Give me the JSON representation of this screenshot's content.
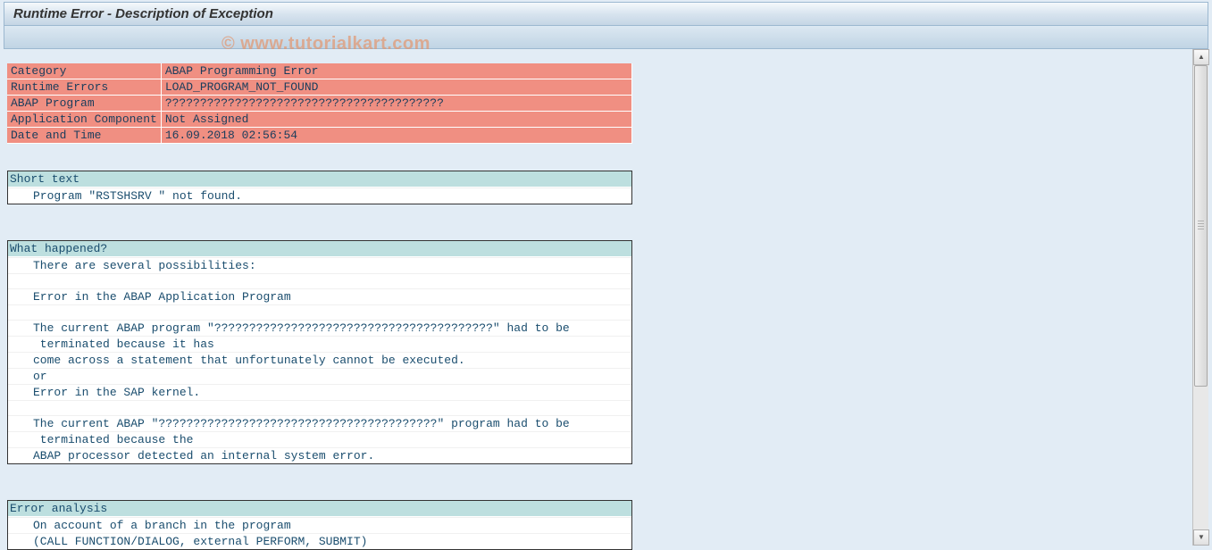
{
  "title": "Runtime Error - Description of Exception",
  "watermark": "© www.tutorialkart.com",
  "header": {
    "rows": [
      {
        "label": "Category",
        "value": "ABAP Programming Error"
      },
      {
        "label": "Runtime Errors",
        "value": "LOAD_PROGRAM_NOT_FOUND"
      },
      {
        "label": "ABAP Program",
        "value": "????????????????????????????????????????"
      },
      {
        "label": "Application Component",
        "value": "Not Assigned"
      },
      {
        "label": "Date and Time",
        "value": "16.09.2018 02:56:54"
      }
    ]
  },
  "sections": [
    {
      "title": "Short text",
      "lines": [
        "Program \"RSTSHSRV \" not found."
      ]
    },
    {
      "title": "What happened?",
      "lines": [
        "There are several possibilities:",
        "",
        "Error in the ABAP Application Program",
        "",
        "The current ABAP program \"????????????????????????????????????????\" had to be",
        " terminated because it has",
        "come across a statement that unfortunately cannot be executed.",
        "or",
        "Error in the SAP kernel.",
        "",
        "The current ABAP \"????????????????????????????????????????\" program had to be",
        " terminated because the",
        "ABAP processor detected an internal system error."
      ]
    },
    {
      "title": "Error analysis",
      "lines": [
        "On account of a branch in the program",
        "(CALL FUNCTION/DIALOG, external PERFORM, SUBMIT)"
      ]
    }
  ]
}
